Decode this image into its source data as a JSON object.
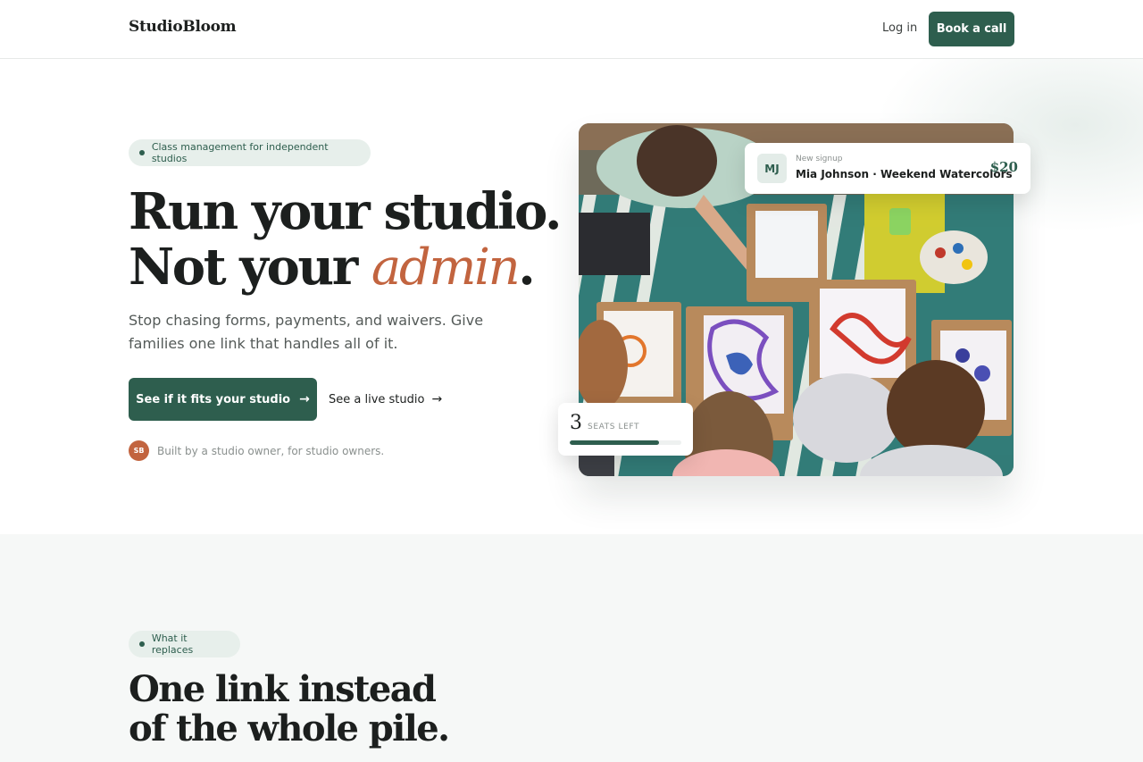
{
  "header": {
    "logo": "StudioBloom",
    "login_label": "Log in",
    "book_label": "Book a call"
  },
  "hero": {
    "pill": "Class management for independent studios",
    "title_line1": "Run your studio.",
    "title_line2_start": "Not your ",
    "title_line2_accent": "admin",
    "title_line2_end": ".",
    "subtitle": "Stop chasing forms, payments, and waivers. Give families one link that handles all of it.",
    "cta_label": "See if it fits your studio",
    "secondary_label": "See a live studio",
    "owner_initials": "SB",
    "owner_text": "Built by a studio owner, for studio owners."
  },
  "signup_card": {
    "initials": "MJ",
    "label": "New signup",
    "detail": "Mia Johnson · Weekend Watercolors",
    "price": "$20"
  },
  "seats_card": {
    "count": "3",
    "label": "SEATS LEFT",
    "progress_fraction": 0.8
  },
  "section2": {
    "pill": "What it replaces",
    "title_line1": "One link instead",
    "title_line2": "of the whole pile."
  },
  "colors": {
    "brand": "#2e5e4e",
    "accent": "#c2643f",
    "pill_bg": "#e7efeb"
  },
  "icons": {
    "cta_arrow": "arrow-right-icon",
    "secondary_arrow": "arrow-right-icon"
  }
}
